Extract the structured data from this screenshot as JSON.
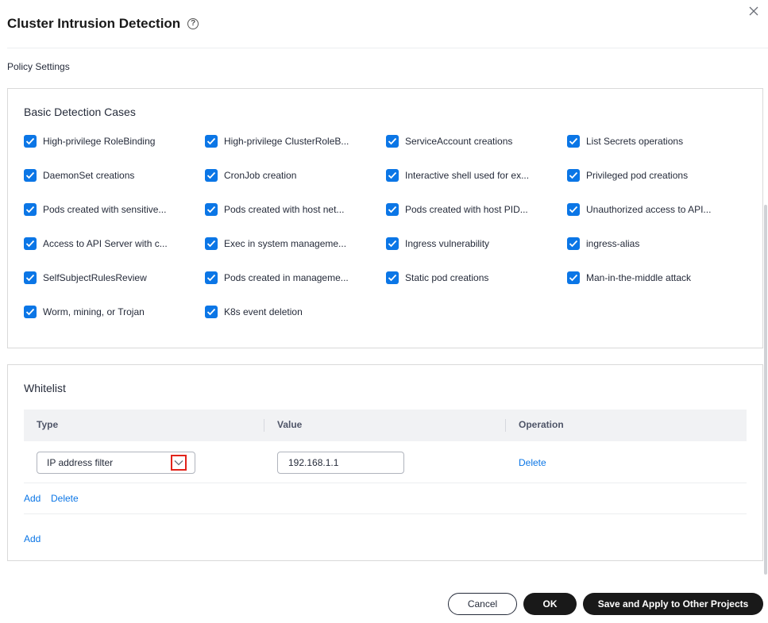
{
  "dialog": {
    "title": "Cluster Intrusion Detection",
    "section_label": "Policy Settings"
  },
  "basic_detection": {
    "title": "Basic Detection Cases",
    "cases": [
      {
        "label": "High-privilege RoleBinding",
        "checked": true
      },
      {
        "label": "High-privilege ClusterRoleB...",
        "checked": true
      },
      {
        "label": "ServiceAccount creations",
        "checked": true
      },
      {
        "label": "List Secrets operations",
        "checked": true
      },
      {
        "label": "DaemonSet creations",
        "checked": true
      },
      {
        "label": "CronJob creation",
        "checked": true
      },
      {
        "label": "Interactive shell used for ex...",
        "checked": true
      },
      {
        "label": "Privileged pod creations",
        "checked": true
      },
      {
        "label": "Pods created with sensitive...",
        "checked": true
      },
      {
        "label": "Pods created with host net...",
        "checked": true
      },
      {
        "label": "Pods created with host PID...",
        "checked": true
      },
      {
        "label": "Unauthorized access to API...",
        "checked": true
      },
      {
        "label": "Access to API Server with c...",
        "checked": true
      },
      {
        "label": "Exec in system manageme...",
        "checked": true
      },
      {
        "label": "Ingress vulnerability",
        "checked": true
      },
      {
        "label": "ingress-alias",
        "checked": true
      },
      {
        "label": "SelfSubjectRulesReview",
        "checked": true
      },
      {
        "label": "Pods created in manageme...",
        "checked": true
      },
      {
        "label": "Static pod creations",
        "checked": true
      },
      {
        "label": "Man-in-the-middle attack",
        "checked": true
      },
      {
        "label": "Worm, mining, or Trojan",
        "checked": true
      },
      {
        "label": "K8s event deletion",
        "checked": true
      }
    ]
  },
  "whitelist": {
    "title": "Whitelist",
    "columns": {
      "type": "Type",
      "value": "Value",
      "operation": "Operation"
    },
    "rows": [
      {
        "type": "IP address filter",
        "value": "192.168.1.1",
        "operation": "Delete"
      }
    ],
    "row_add": "Add",
    "row_delete": "Delete",
    "group_add": "Add"
  },
  "footer": {
    "cancel": "Cancel",
    "ok": "OK",
    "save_apply": "Save and Apply to Other Projects"
  },
  "colors": {
    "accent": "#0b76e6",
    "primary_button": "#191919",
    "highlight_box": "#e2231a"
  }
}
